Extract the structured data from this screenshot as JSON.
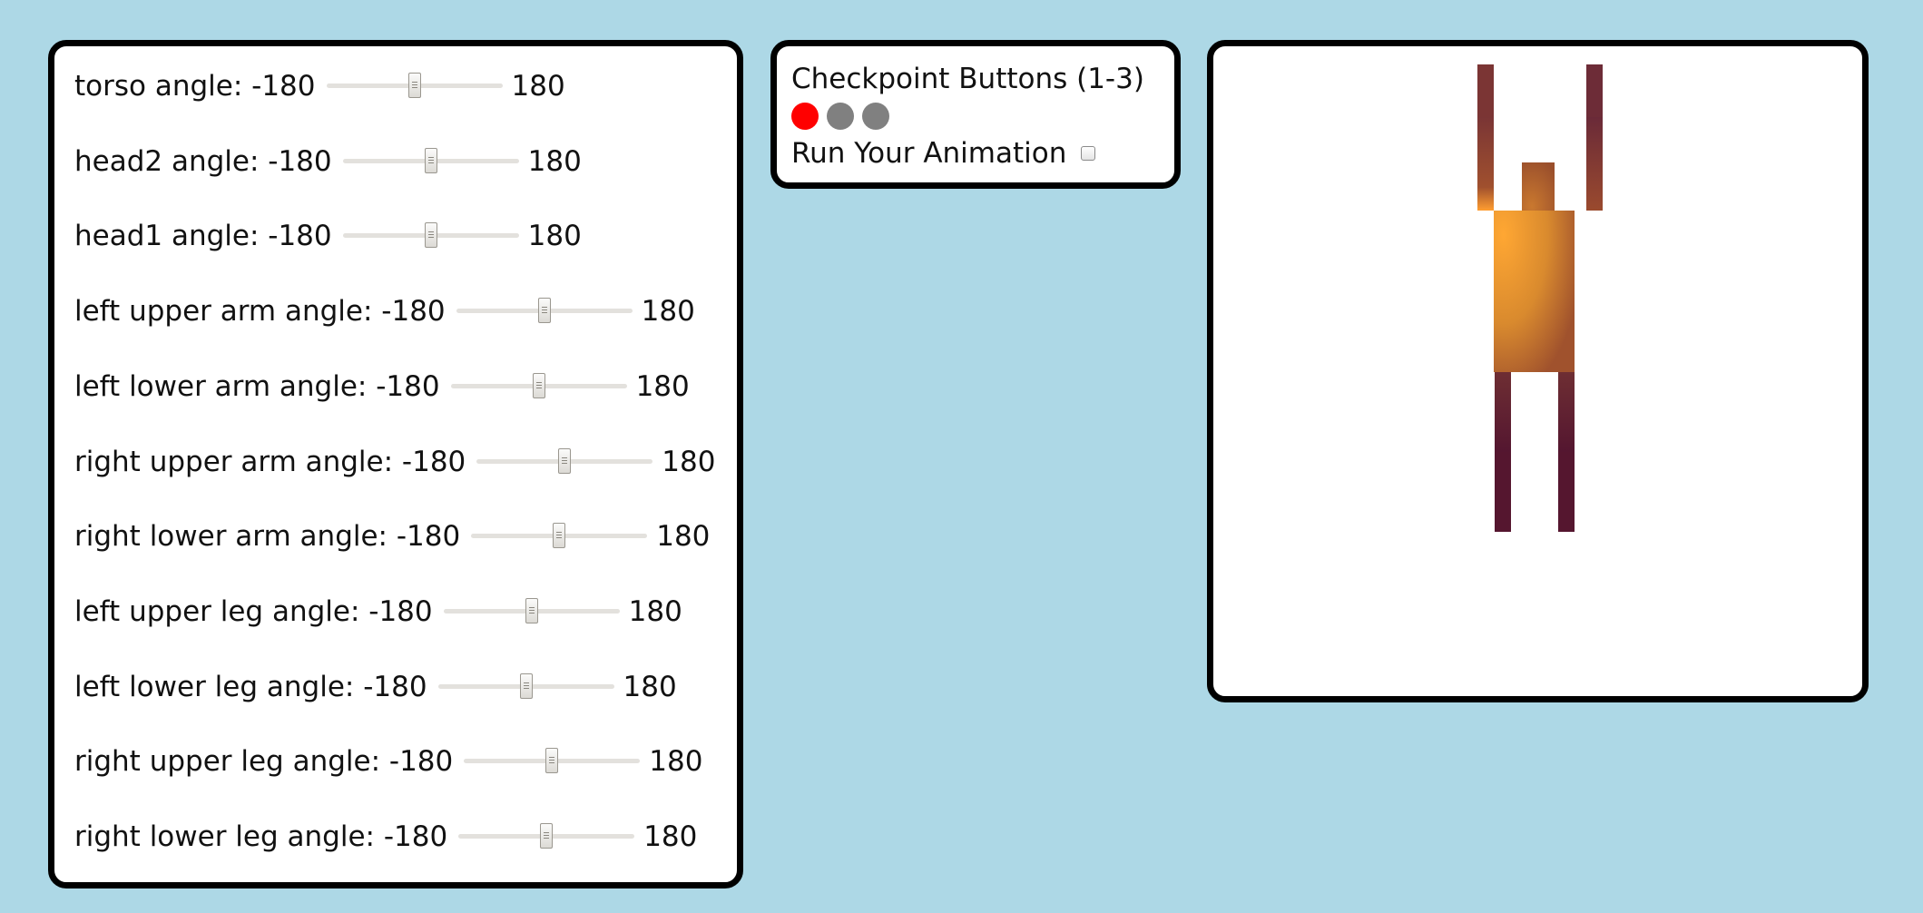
{
  "sliders": [
    {
      "label": "torso angle: -180",
      "max_label": "180",
      "value_fraction": 0.5
    },
    {
      "label": "head2 angle: -180",
      "max_label": "180",
      "value_fraction": 0.5
    },
    {
      "label": "head1 angle: -180",
      "max_label": "180",
      "value_fraction": 0.5
    },
    {
      "label": "left upper arm angle: -180",
      "max_label": "180",
      "value_fraction": 0.5
    },
    {
      "label": "left lower arm angle: -180",
      "max_label": "180",
      "value_fraction": 0.5
    },
    {
      "label": "right upper arm angle: -180",
      "max_label": "180",
      "value_fraction": 0.5
    },
    {
      "label": "right lower arm angle: -180",
      "max_label": "180",
      "value_fraction": 0.5
    },
    {
      "label": "left upper leg angle: -180",
      "max_label": "180",
      "value_fraction": 0.5
    },
    {
      "label": "left lower leg angle: -180",
      "max_label": "180",
      "value_fraction": 0.5
    },
    {
      "label": "right upper leg angle: -180",
      "max_label": "180",
      "value_fraction": 0.5
    },
    {
      "label": "right lower leg angle: -180",
      "max_label": "180",
      "value_fraction": 0.5
    }
  ],
  "checkpoints": {
    "title": "Checkpoint Buttons (1-3)",
    "buttons": [
      {
        "active": true
      },
      {
        "active": false
      },
      {
        "active": false
      }
    ],
    "run_label": "Run Your Animation",
    "run_checked": false
  },
  "colors": {
    "background": "#add8e6",
    "panel_border": "#000000",
    "active_checkpoint": "#ff0000",
    "inactive_checkpoint": "#808080",
    "figure_torso_highlight": "#ffa733",
    "figure_torso_shade": "#a0522d",
    "figure_limb_light": "#8b4a2b",
    "figure_limb_dark": "#5a1a30"
  }
}
